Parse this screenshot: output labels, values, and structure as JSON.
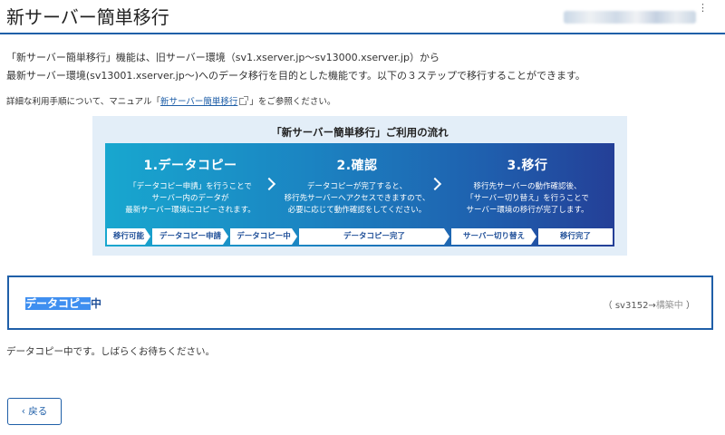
{
  "header": {
    "title": "新サーバー簡単移行",
    "menu_icon": "⋮"
  },
  "description": {
    "line1": "「新サーバー簡単移行」機能は、旧サーバー環境（sv1.xserver.jp〜sv13000.xserver.jp）から",
    "line2": "最新サーバー環境(sv13001.xserver.jp〜)へのデータ移行を目的とした機能です。以下の３ステップで移行することができます。",
    "manual_prefix": "詳細な利用手順について、マニュアル「",
    "manual_link": "新サーバー簡単移行",
    "manual_suffix": "」をご参照ください。"
  },
  "flow": {
    "title": "「新サーバー簡単移行」ご利用の流れ",
    "steps": [
      {
        "title": "1.データコピー",
        "lines": [
          "「データコピー申請」を行うことで",
          "サーバー内のデータが",
          "最新サーバー環境にコピーされます。"
        ]
      },
      {
        "title": "2.確認",
        "lines": [
          "データコピーが完了すると、",
          "移行先サーバーへアクセスできますので、",
          "必要に応じて動作確認をしてください。"
        ]
      },
      {
        "title": "3.移行",
        "lines": [
          "移行先サーバーの動作確認後、",
          "「サーバー切り替え」を行うことで",
          "サーバー環境の移行が完了します。"
        ]
      }
    ],
    "stages": [
      "移行可能",
      "データコピー申請",
      "データコピー中",
      "データコピー完了",
      "サーバー切り替え",
      "移行完了"
    ]
  },
  "status": {
    "label_highlighted": "データコピー",
    "label_rest": "中",
    "server_prefix": "（ sv3152→",
    "server_muted": "構築中",
    "server_suffix": " ）"
  },
  "message": "データコピー中です。しばらくお待ちください。",
  "back_button": {
    "arrow": "‹",
    "label": "戻る"
  },
  "colors": {
    "accent": "#1f5fa8",
    "flow_gradient_start": "#18a7cf",
    "flow_gradient_end": "#243f97",
    "highlight": "#3f8ff0"
  }
}
